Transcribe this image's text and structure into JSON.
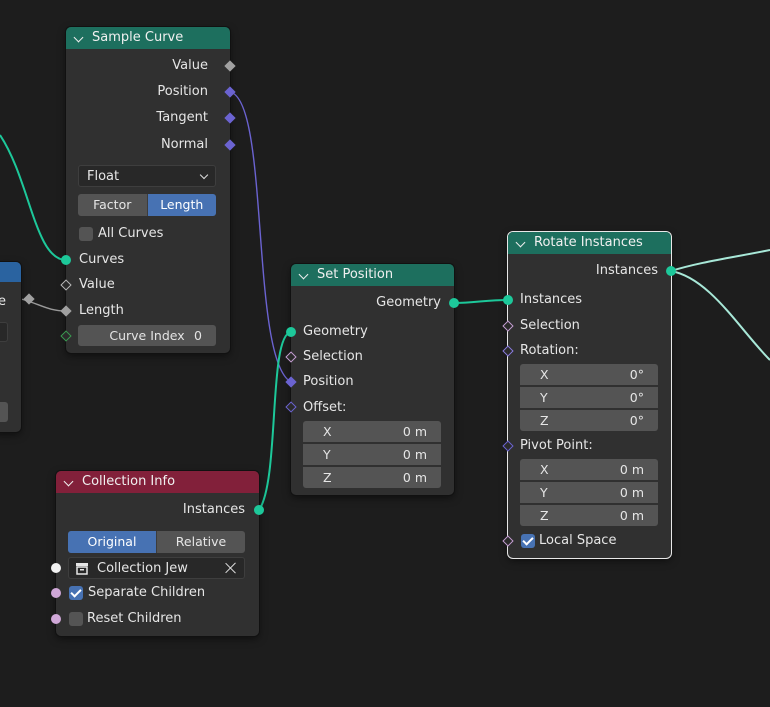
{
  "sample_curve": {
    "title": "Sample Curve",
    "outputs": [
      "Value",
      "Position",
      "Tangent",
      "Normal"
    ],
    "data_type": "Float",
    "mode_options": [
      "Factor",
      "Length"
    ],
    "mode_selected": "Length",
    "all_curves": "All Curves",
    "inputs": {
      "curves": "Curves",
      "value": "Value",
      "length": "Length",
      "curve_index_label": "Curve Index",
      "curve_index_value": "0"
    }
  },
  "left_partial": {
    "socket_label_fragment": "e"
  },
  "set_position": {
    "title": "Set Position",
    "output": "Geometry",
    "inputs": [
      "Geometry",
      "Selection",
      "Position",
      "Offset:"
    ],
    "offset": {
      "x_label": "X",
      "x": "0 m",
      "y_label": "Y",
      "y": "0 m",
      "z_label": "Z",
      "z": "0 m"
    }
  },
  "rotate_instances": {
    "title": "Rotate Instances",
    "output": "Instances",
    "inputs": {
      "instances": "Instances",
      "selection": "Selection",
      "rotation": "Rotation:",
      "pivot": "Pivot Point:"
    },
    "rotation": {
      "x_label": "X",
      "x": "0°",
      "y_label": "Y",
      "y": "0°",
      "z_label": "Z",
      "z": "0°"
    },
    "pivot_point": {
      "x_label": "X",
      "x": "0 m",
      "y_label": "Y",
      "y": "0 m",
      "z_label": "Z",
      "z": "0 m"
    },
    "local_space": "Local Space"
  },
  "collection_info": {
    "title": "Collection Info",
    "output": "Instances",
    "transform_options": [
      "Original",
      "Relative"
    ],
    "transform_selected": "Original",
    "collection": "Collection Jew",
    "separate_children": "Separate Children",
    "reset_children": "Reset Children"
  },
  "colors": {
    "geometry_socket": "#1dc89a",
    "vector_socket": "#6b63d1",
    "float_socket": "#a0a0a0",
    "boolean_socket": "#d0a8d8",
    "geometry_header": "#1d6f5e",
    "instance_header": "#82203a",
    "selected_button": "#4772b3"
  }
}
